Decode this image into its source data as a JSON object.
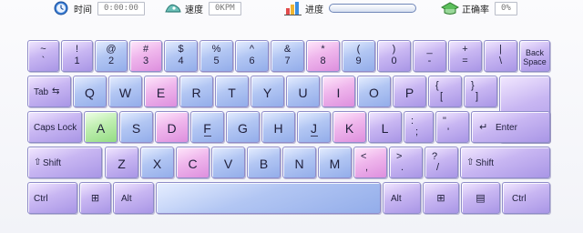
{
  "status": {
    "time_label": "时间",
    "time_value": "0:00:00",
    "speed_label": "速度",
    "speed_value": "0KPM",
    "progress_label": "进度",
    "progress_value": 0,
    "accuracy_label": "正确率",
    "accuracy_value": "0%"
  },
  "colors": {
    "purple": "#b9a6ee",
    "blue": "#a4bbf0",
    "pink": "#e8a3e6",
    "green": "#a8e498"
  },
  "keyboard": {
    "row1": [
      {
        "top": "~",
        "bottom": "`"
      },
      {
        "top": "!",
        "bottom": "1"
      },
      {
        "top": "@",
        "bottom": "2"
      },
      {
        "top": "#",
        "bottom": "3"
      },
      {
        "top": "$",
        "bottom": "4"
      },
      {
        "top": "%",
        "bottom": "5"
      },
      {
        "top": "^",
        "bottom": "6"
      },
      {
        "top": "&",
        "bottom": "7"
      },
      {
        "top": "*",
        "bottom": "8"
      },
      {
        "top": "(",
        "bottom": "9"
      },
      {
        "top": ")",
        "bottom": "0"
      },
      {
        "top": "_",
        "bottom": "-"
      },
      {
        "top": "+",
        "bottom": "="
      },
      {
        "top": "|",
        "bottom": "\\"
      },
      {
        "label_line1": "Back",
        "label_line2": "Space"
      }
    ],
    "row2": {
      "tab_label": "Tab",
      "keys": [
        "Q",
        "W",
        "E",
        "R",
        "T",
        "Y",
        "U",
        "I",
        "O",
        "P"
      ],
      "bracket_left": {
        "top": "{",
        "bottom": "["
      },
      "bracket_right": {
        "top": "}",
        "bottom": "]"
      }
    },
    "row3": {
      "caps_label": "Caps Lock",
      "keys": [
        "A",
        "S",
        "D",
        "F",
        "G",
        "H",
        "J",
        "K",
        "L"
      ],
      "semicolon": {
        "top": ":",
        "bottom": ";"
      },
      "quote": {
        "top": "\"",
        "bottom": "'"
      },
      "enter_label": "Enter"
    },
    "row4": {
      "lshift_label": "Shift",
      "keys": [
        "Z",
        "X",
        "C",
        "V",
        "B",
        "N",
        "M"
      ],
      "comma": {
        "top": "<",
        "bottom": ","
      },
      "period": {
        "top": ">",
        "bottom": "."
      },
      "slash": {
        "top": "?",
        "bottom": "/"
      },
      "rshift_label": "Shift"
    },
    "row5": {
      "lctrl_label": "Ctrl",
      "lalt_label": "Alt",
      "ralt_label": "Alt",
      "rctrl_label": "Ctrl"
    }
  }
}
